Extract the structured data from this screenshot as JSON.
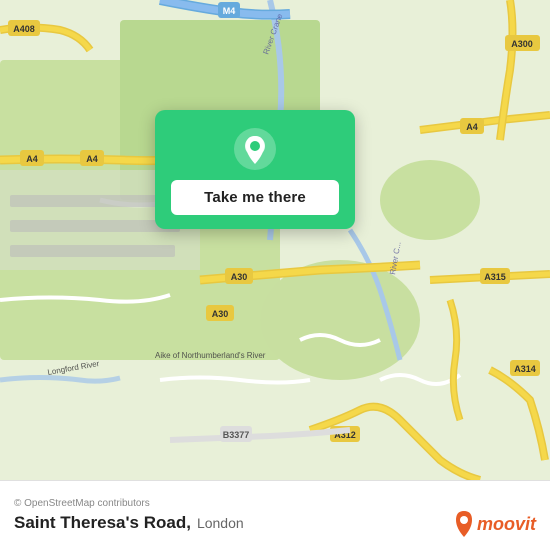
{
  "map": {
    "attribution": "© OpenStreetMap contributors",
    "accent_color": "#2ecc7a"
  },
  "popup": {
    "button_label": "Take me there"
  },
  "bottom_bar": {
    "location_name": "Saint Theresa's Road,",
    "location_city": "London"
  },
  "moovit": {
    "brand_name": "moovit"
  }
}
